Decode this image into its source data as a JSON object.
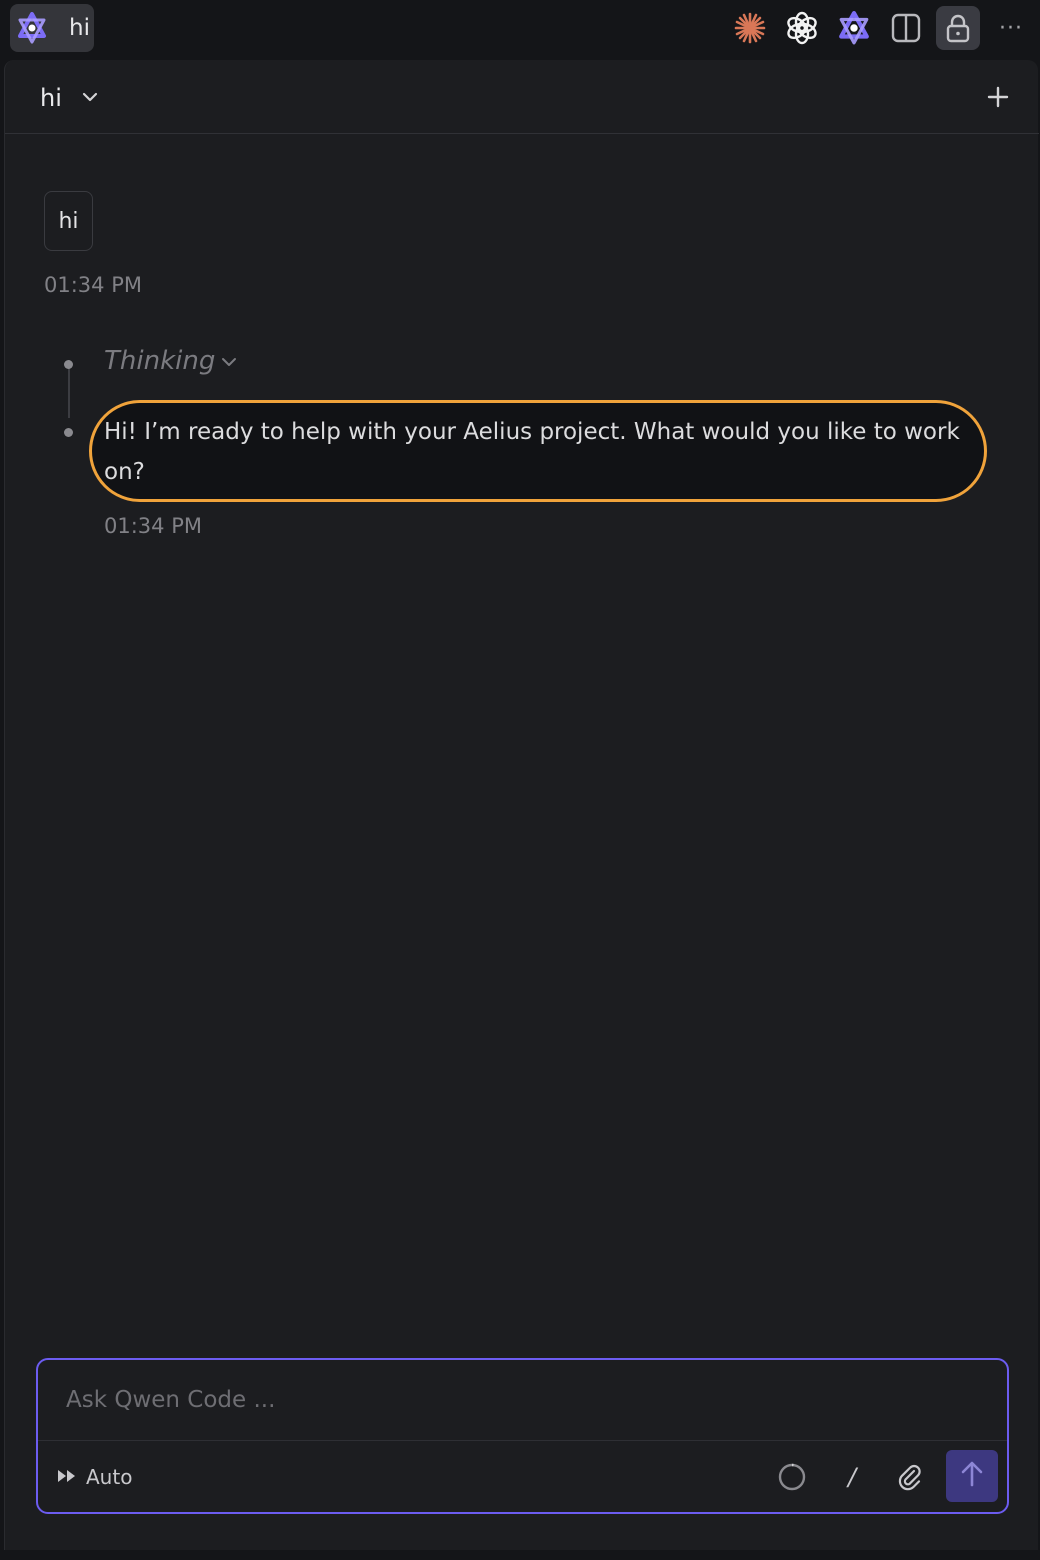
{
  "tab": {
    "label": "hi",
    "icon": "qwen-icon"
  },
  "toolbar": {
    "icons": [
      "claude-icon",
      "openai-icon",
      "qwen-icon",
      "split-view-icon",
      "lock-icon",
      "more-icon"
    ],
    "more_label": "···"
  },
  "header": {
    "title": "hi"
  },
  "conversation": {
    "user_message": "hi",
    "user_time": "01:34 PM",
    "thinking_label": "Thinking",
    "assistant_message": "Hi! I’m ready to help with your Aelius project. What would you like to work on?",
    "assistant_time": "01:34 PM"
  },
  "composer": {
    "placeholder": "Ask Qwen Code ...",
    "value": "",
    "mode_label": "Auto",
    "slash_label": "/"
  },
  "colors": {
    "accent": "#6c5cf0",
    "highlight": "#f0a33b",
    "send_bg": "#3d3880",
    "claude": "#d97757",
    "qwen": "#7c6cf5"
  }
}
